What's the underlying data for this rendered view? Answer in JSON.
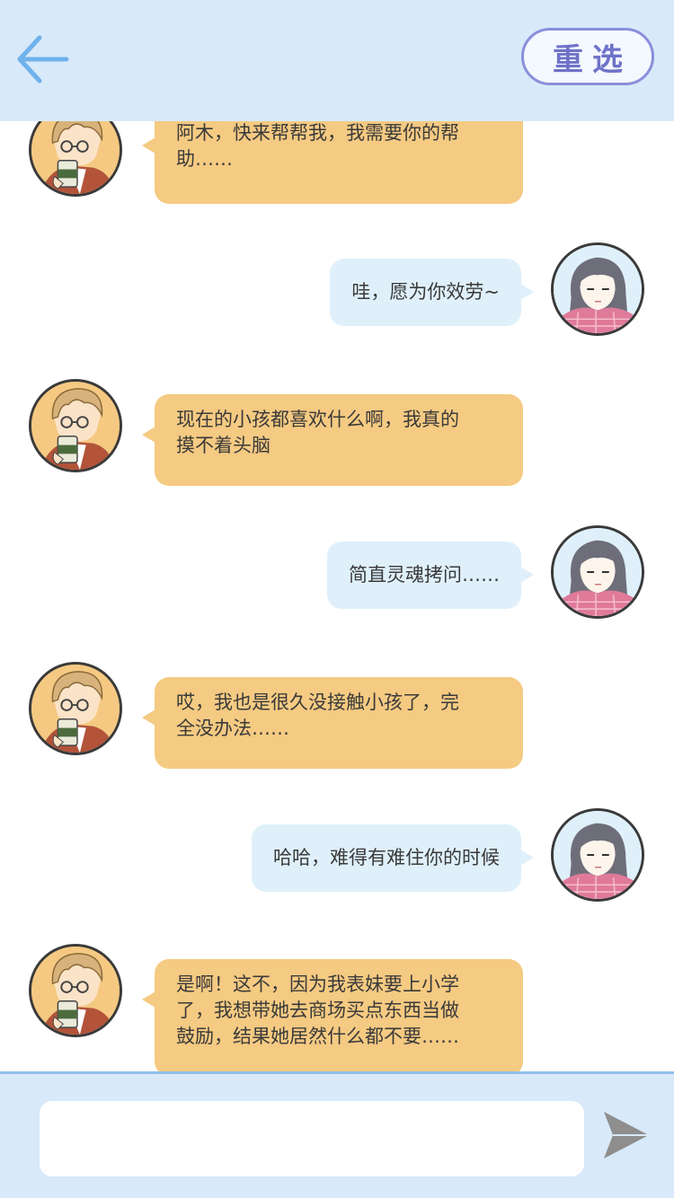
{
  "header": {
    "back_icon": "arrow-left-icon",
    "reselect_label": "重选"
  },
  "messages": [
    {
      "sender": "boy",
      "text": "阿木，快来帮帮我，我需要你的帮\n助……"
    },
    {
      "sender": "girl",
      "text": "哇，愿为你效劳~"
    },
    {
      "sender": "boy",
      "text": "现在的小孩都喜欢什么啊，我真的\n摸不着头脑"
    },
    {
      "sender": "girl",
      "text": "简直灵魂拷问……"
    },
    {
      "sender": "boy",
      "text": "哎，我也是很久没接触小孩了，完\n全没办法……"
    },
    {
      "sender": "girl",
      "text": "哈哈，难得有难住你的时候"
    },
    {
      "sender": "boy",
      "text": "是啊！这不，因为我表妹要上小学\n了，我想带她去商场买点东西当做\n鼓励，结果她居然什么都不要……"
    }
  ],
  "composer": {
    "input_value": "",
    "input_placeholder": "",
    "send_icon": "send-icon"
  },
  "colors": {
    "header_bg": "#d8e9f9",
    "boy_bubble": "#f5ca82",
    "girl_bubble": "#dff0fb",
    "reselect_border": "#8a8fdb",
    "back_arrow": "#6fb2ec"
  }
}
